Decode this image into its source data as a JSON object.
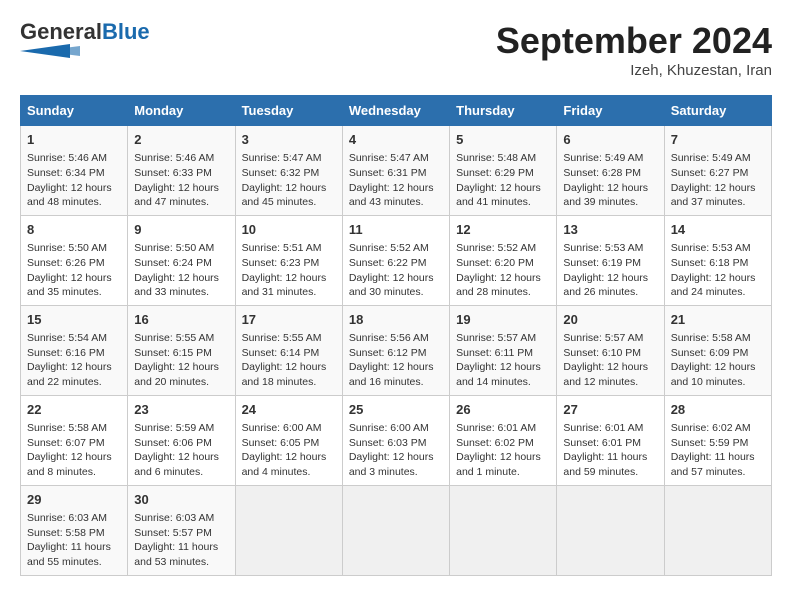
{
  "header": {
    "logo_general": "General",
    "logo_blue": "Blue",
    "month_title": "September 2024",
    "location": "Izeh, Khuzestan, Iran"
  },
  "days_of_week": [
    "Sunday",
    "Monday",
    "Tuesday",
    "Wednesday",
    "Thursday",
    "Friday",
    "Saturday"
  ],
  "weeks": [
    [
      {
        "day": "1",
        "info": "Sunrise: 5:46 AM\nSunset: 6:34 PM\nDaylight: 12 hours and 48 minutes."
      },
      {
        "day": "2",
        "info": "Sunrise: 5:46 AM\nSunset: 6:33 PM\nDaylight: 12 hours and 47 minutes."
      },
      {
        "day": "3",
        "info": "Sunrise: 5:47 AM\nSunset: 6:32 PM\nDaylight: 12 hours and 45 minutes."
      },
      {
        "day": "4",
        "info": "Sunrise: 5:47 AM\nSunset: 6:31 PM\nDaylight: 12 hours and 43 minutes."
      },
      {
        "day": "5",
        "info": "Sunrise: 5:48 AM\nSunset: 6:29 PM\nDaylight: 12 hours and 41 minutes."
      },
      {
        "day": "6",
        "info": "Sunrise: 5:49 AM\nSunset: 6:28 PM\nDaylight: 12 hours and 39 minutes."
      },
      {
        "day": "7",
        "info": "Sunrise: 5:49 AM\nSunset: 6:27 PM\nDaylight: 12 hours and 37 minutes."
      }
    ],
    [
      {
        "day": "8",
        "info": "Sunrise: 5:50 AM\nSunset: 6:26 PM\nDaylight: 12 hours and 35 minutes."
      },
      {
        "day": "9",
        "info": "Sunrise: 5:50 AM\nSunset: 6:24 PM\nDaylight: 12 hours and 33 minutes."
      },
      {
        "day": "10",
        "info": "Sunrise: 5:51 AM\nSunset: 6:23 PM\nDaylight: 12 hours and 31 minutes."
      },
      {
        "day": "11",
        "info": "Sunrise: 5:52 AM\nSunset: 6:22 PM\nDaylight: 12 hours and 30 minutes."
      },
      {
        "day": "12",
        "info": "Sunrise: 5:52 AM\nSunset: 6:20 PM\nDaylight: 12 hours and 28 minutes."
      },
      {
        "day": "13",
        "info": "Sunrise: 5:53 AM\nSunset: 6:19 PM\nDaylight: 12 hours and 26 minutes."
      },
      {
        "day": "14",
        "info": "Sunrise: 5:53 AM\nSunset: 6:18 PM\nDaylight: 12 hours and 24 minutes."
      }
    ],
    [
      {
        "day": "15",
        "info": "Sunrise: 5:54 AM\nSunset: 6:16 PM\nDaylight: 12 hours and 22 minutes."
      },
      {
        "day": "16",
        "info": "Sunrise: 5:55 AM\nSunset: 6:15 PM\nDaylight: 12 hours and 20 minutes."
      },
      {
        "day": "17",
        "info": "Sunrise: 5:55 AM\nSunset: 6:14 PM\nDaylight: 12 hours and 18 minutes."
      },
      {
        "day": "18",
        "info": "Sunrise: 5:56 AM\nSunset: 6:12 PM\nDaylight: 12 hours and 16 minutes."
      },
      {
        "day": "19",
        "info": "Sunrise: 5:57 AM\nSunset: 6:11 PM\nDaylight: 12 hours and 14 minutes."
      },
      {
        "day": "20",
        "info": "Sunrise: 5:57 AM\nSunset: 6:10 PM\nDaylight: 12 hours and 12 minutes."
      },
      {
        "day": "21",
        "info": "Sunrise: 5:58 AM\nSunset: 6:09 PM\nDaylight: 12 hours and 10 minutes."
      }
    ],
    [
      {
        "day": "22",
        "info": "Sunrise: 5:58 AM\nSunset: 6:07 PM\nDaylight: 12 hours and 8 minutes."
      },
      {
        "day": "23",
        "info": "Sunrise: 5:59 AM\nSunset: 6:06 PM\nDaylight: 12 hours and 6 minutes."
      },
      {
        "day": "24",
        "info": "Sunrise: 6:00 AM\nSunset: 6:05 PM\nDaylight: 12 hours and 4 minutes."
      },
      {
        "day": "25",
        "info": "Sunrise: 6:00 AM\nSunset: 6:03 PM\nDaylight: 12 hours and 3 minutes."
      },
      {
        "day": "26",
        "info": "Sunrise: 6:01 AM\nSunset: 6:02 PM\nDaylight: 12 hours and 1 minute."
      },
      {
        "day": "27",
        "info": "Sunrise: 6:01 AM\nSunset: 6:01 PM\nDaylight: 11 hours and 59 minutes."
      },
      {
        "day": "28",
        "info": "Sunrise: 6:02 AM\nSunset: 5:59 PM\nDaylight: 11 hours and 57 minutes."
      }
    ],
    [
      {
        "day": "29",
        "info": "Sunrise: 6:03 AM\nSunset: 5:58 PM\nDaylight: 11 hours and 55 minutes."
      },
      {
        "day": "30",
        "info": "Sunrise: 6:03 AM\nSunset: 5:57 PM\nDaylight: 11 hours and 53 minutes."
      },
      {
        "day": "",
        "info": ""
      },
      {
        "day": "",
        "info": ""
      },
      {
        "day": "",
        "info": ""
      },
      {
        "day": "",
        "info": ""
      },
      {
        "day": "",
        "info": ""
      }
    ]
  ]
}
